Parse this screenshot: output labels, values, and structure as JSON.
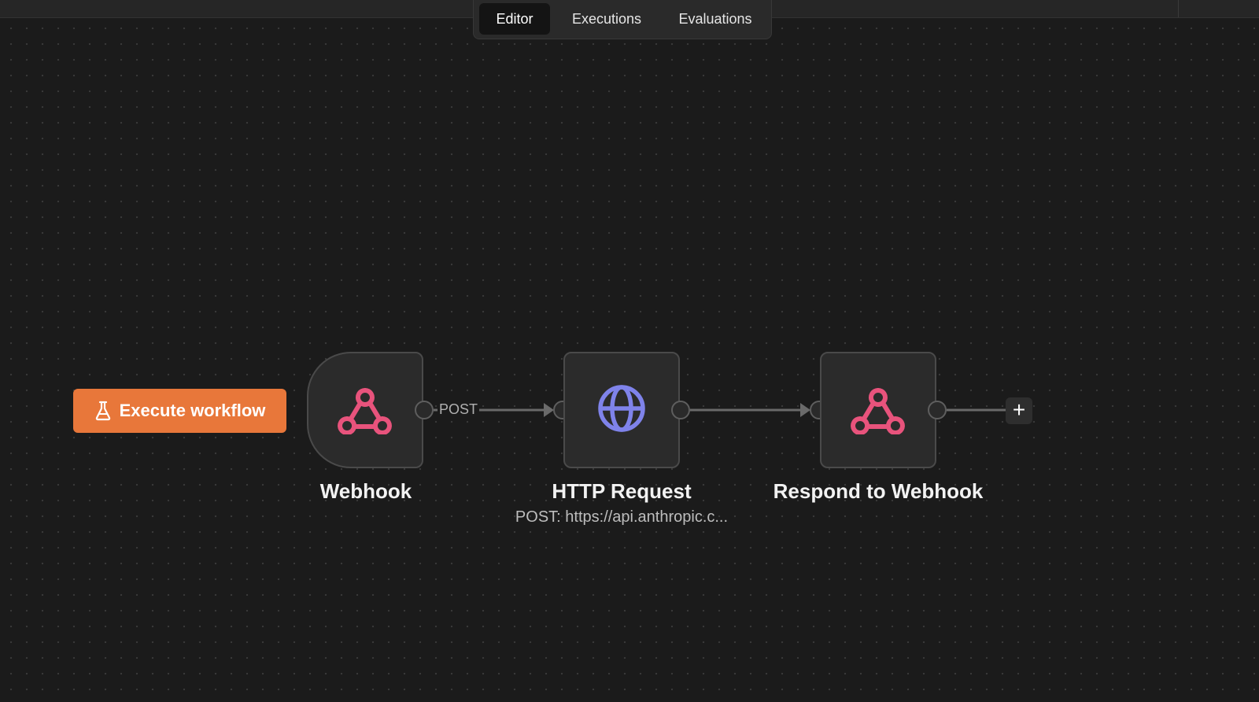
{
  "tabs": [
    {
      "label": "Editor",
      "active": true
    },
    {
      "label": "Executions",
      "active": false
    },
    {
      "label": "Evaluations",
      "active": false
    }
  ],
  "execute_button": {
    "label": "Execute workflow",
    "icon": "flask-icon",
    "color": "#e8773a"
  },
  "nodes": [
    {
      "label": "Webhook",
      "icon": "webhook-icon",
      "subtitle": ""
    },
    {
      "label": "HTTP Request",
      "icon": "globe-icon",
      "subtitle": "POST: https://api.anthropic.c..."
    },
    {
      "label": "Respond to Webhook",
      "icon": "webhook-icon",
      "subtitle": ""
    }
  ],
  "edges": [
    {
      "label": "POST"
    }
  ],
  "add_node_button": {
    "label": "+"
  },
  "colors": {
    "webhook_icon": "#e8537c",
    "globe_icon": "#7f83ea",
    "canvas": "#1b1b1b",
    "node_bg": "#2b2b2b"
  }
}
